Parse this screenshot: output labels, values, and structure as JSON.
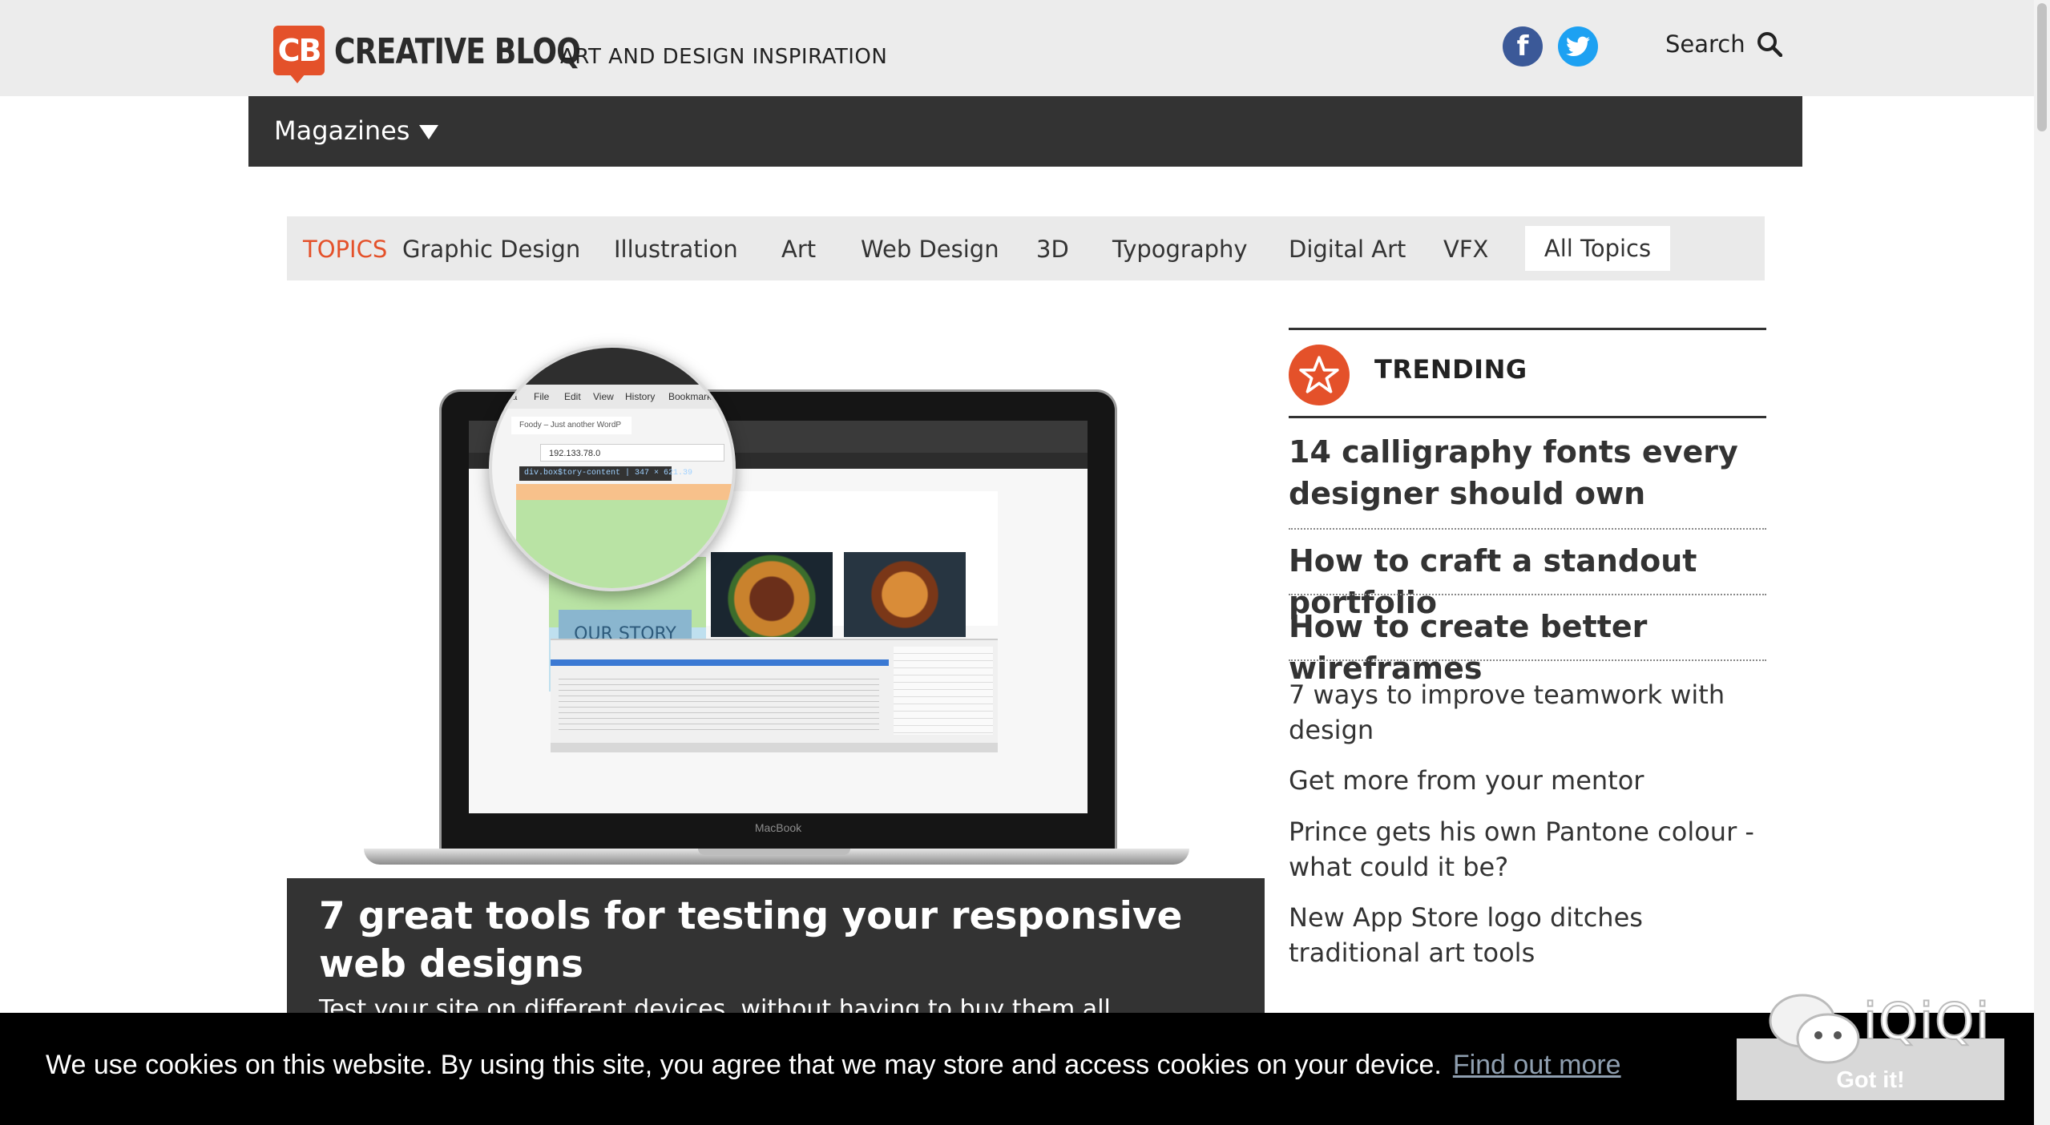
{
  "header": {
    "logo_mark": "CB",
    "logo_word": "CREATIVE BLOQ",
    "tagline": "ART AND DESIGN INSPIRATION",
    "search_label": "Search",
    "facebook_glyph": "f"
  },
  "magazines": {
    "label": "Magazines"
  },
  "topics": {
    "label": "TOPICS",
    "items": [
      "Graphic Design",
      "Illustration",
      "Art",
      "Web Design",
      "3D",
      "Typography",
      "Digital Art",
      "VFX"
    ],
    "all_label": "All Topics"
  },
  "hero": {
    "screen": {
      "menu": [
        "era",
        "File",
        "Edit",
        "View",
        "History",
        "Bookmarks"
      ],
      "tab": "Foody – Just another WordP",
      "url": "192.133.78.0",
      "element_tag": "div.box$tory-content | 347 × 621.39",
      "story_label": "OUR STORY",
      "device_label": "MacBook"
    },
    "title": "7 great tools for testing your responsive web designs",
    "subtitle": "Test your site on different devices, without having to buy them all"
  },
  "trending": {
    "label": "TRENDING",
    "featured": [
      "14 calligraphy fonts every designer should own",
      "How to craft a standout portfolio",
      "How to create better wireframes"
    ],
    "more": [
      "7 ways to improve teamwork with design",
      "Get more from your mentor",
      "Prince gets his own Pantone colour - what could it be?",
      "New App Store logo ditches traditional art tools"
    ]
  },
  "cookie": {
    "message": "We use cookies on this website. By using this site, you agree that we may store and access cookies on your device.",
    "link_label": "Find out more",
    "button_label": "Got it!"
  },
  "watermark": {
    "text": "iQiQi"
  },
  "colors": {
    "brand_orange": "#e4512a",
    "dark_bar": "#333333",
    "facebook_blue": "#3b5998",
    "twitter_blue": "#1da1f2"
  },
  "icons": [
    "facebook-icon",
    "twitter-icon",
    "search-icon",
    "dropdown-triangle-icon",
    "star-icon",
    "chat-bubbles-icon"
  ]
}
